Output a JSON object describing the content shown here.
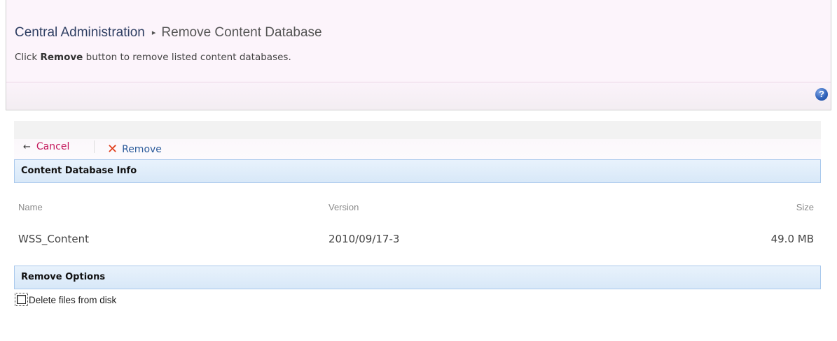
{
  "header": {
    "breadcrumb_root": "Central Administration",
    "breadcrumb_separator": "▸",
    "breadcrumb_current": "Remove Content Database",
    "subtitle_prefix": "Click",
    "subtitle_bold": "Remove",
    "subtitle_suffix": "button to remove listed content databases.",
    "help_label": "?"
  },
  "toolbar": {
    "cancel_icon": "←",
    "cancel_label": "Cancel",
    "remove_icon": "✕",
    "remove_label": "Remove"
  },
  "info_section": {
    "title": "Content Database Info",
    "columns": [
      "Name",
      "Version",
      "Size"
    ],
    "row": {
      "name": "WSS_Content",
      "version": "2010/09/17-3",
      "size": "49.0 MB"
    }
  },
  "options_section": {
    "title": "Remove Options",
    "delete_files_label": "Delete files from disk",
    "delete_files_checked": false
  },
  "colors": {
    "header_bg": "#fcf4fb",
    "section_header_bg": "#dce9f8",
    "cancel_link": "#c4195c",
    "remove_link": "#2a5a9a",
    "remove_icon": "#e03a16"
  },
  "icons": {
    "help": "help-icon",
    "cancel": "back-arrow-icon",
    "remove": "red-x-icon"
  }
}
